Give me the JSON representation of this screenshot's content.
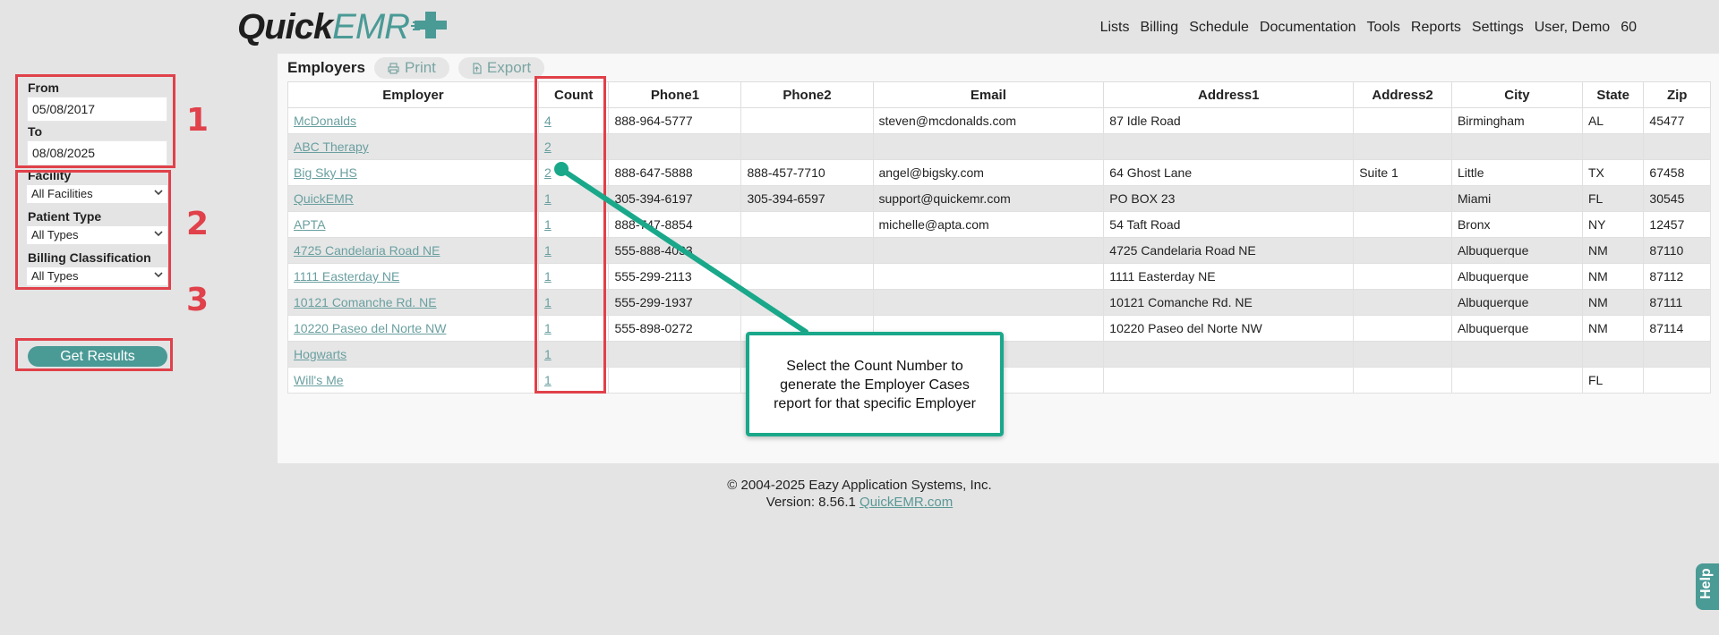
{
  "app": {
    "logo_quick": "Quick",
    "logo_emr": "EMR",
    "brand_color": "#4a9a96",
    "accent_red": "#e0414a",
    "callout_color": "#1aa88a"
  },
  "nav": {
    "items": [
      "Lists",
      "Billing",
      "Schedule",
      "Documentation",
      "Tools",
      "Reports",
      "Settings",
      "User, Demo",
      "60"
    ]
  },
  "filters": {
    "from_label": "From",
    "from_value": "05/08/2017",
    "to_label": "To",
    "to_value": "08/08/2025",
    "facility_label": "Facility",
    "facility_value": "All Facilities",
    "patient_type_label": "Patient Type",
    "patient_type_value": "All Types",
    "billing_class_label": "Billing Classification",
    "billing_class_value": "All Types",
    "get_results_label": "Get Results",
    "step_numbers": [
      "1",
      "2",
      "3"
    ]
  },
  "report": {
    "title": "Employers",
    "print_label": "Print",
    "export_label": "Export",
    "columns": [
      "Employer",
      "Count",
      "Phone1",
      "Phone2",
      "Email",
      "Address1",
      "Address2",
      "City",
      "State",
      "Zip"
    ],
    "rows": [
      [
        "McDonalds",
        "4",
        "888-964-5777",
        "",
        "steven@mcdonalds.com",
        "87 Idle Road",
        "",
        "Birmingham",
        "AL",
        "45477"
      ],
      [
        "ABC Therapy",
        "2",
        "",
        "",
        "",
        "",
        "",
        "",
        "",
        ""
      ],
      [
        "Big Sky HS",
        "2",
        "888-647-5888",
        "888-457-7710",
        "angel@bigsky.com",
        "64 Ghost Lane",
        "Suite 1",
        "Little",
        "TX",
        "67458"
      ],
      [
        "QuickEMR",
        "1",
        "305-394-6197",
        "305-394-6597",
        "support@quickemr.com",
        "PO BOX 23",
        "",
        "Miami",
        "FL",
        "30545"
      ],
      [
        "APTA",
        "1",
        "888-747-8854",
        "",
        "michelle@apta.com",
        "54 Taft Road",
        "",
        "Bronx",
        "NY",
        "12457"
      ],
      [
        "4725 Candelaria Road NE",
        "1",
        "555-888-4033",
        "",
        "",
        "4725 Candelaria Road NE",
        "",
        "Albuquerque",
        "NM",
        "87110"
      ],
      [
        "1111 Easterday NE",
        "1",
        "555-299-2113",
        "",
        "",
        "1111 Easterday NE",
        "",
        "Albuquerque",
        "NM",
        "87112"
      ],
      [
        "10121 Comanche Rd. NE",
        "1",
        "555-299-1937",
        "",
        "",
        "10121 Comanche Rd. NE",
        "",
        "Albuquerque",
        "NM",
        "87111"
      ],
      [
        "10220 Paseo del Norte NW",
        "1",
        "555-898-0272",
        "",
        "",
        "10220 Paseo del Norte NW",
        "",
        "Albuquerque",
        "NM",
        "87114"
      ],
      [
        "Hogwarts",
        "1",
        "",
        "",
        "",
        "",
        "",
        "",
        "",
        ""
      ],
      [
        "Will's Me",
        "1",
        "",
        "",
        "",
        "",
        "",
        "",
        "FL",
        ""
      ]
    ]
  },
  "callout": {
    "text": "Select the Count Number to generate the Employer Cases report for that specific Employer"
  },
  "footer": {
    "copyright": "© 2004-2025 Eazy Application Systems, Inc.",
    "version_label": "Version: 8.56.1",
    "link_text": "QuickEMR.com"
  },
  "help": {
    "label": "Help"
  }
}
